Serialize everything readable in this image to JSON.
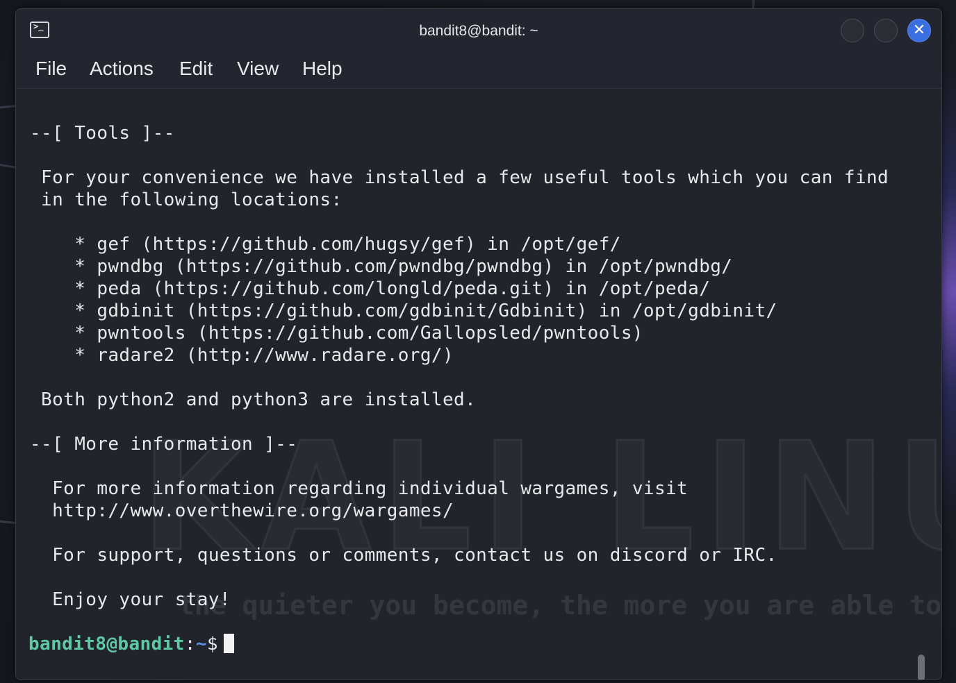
{
  "window": {
    "title": "bandit8@bandit: ~",
    "icon": "terminal-icon"
  },
  "menu": {
    "items": [
      "File",
      "Actions",
      "Edit",
      "View",
      "Help"
    ]
  },
  "background": {
    "watermark": "KALI LINUX",
    "tagline": "the quieter you become, the more you are able to"
  },
  "terminal": {
    "lines": [
      "--[ Tools ]--",
      " For your convenience we have installed a few useful tools which you can find",
      " in the following locations:",
      "    * gef (https://github.com/hugsy/gef) in /opt/gef/",
      "    * pwndbg (https://github.com/pwndbg/pwndbg) in /opt/pwndbg/",
      "    * peda (https://github.com/longld/peda.git) in /opt/peda/",
      "    * gdbinit (https://github.com/gdbinit/Gdbinit) in /opt/gdbinit/",
      "    * pwntools (https://github.com/Gallopsled/pwntools)",
      "    * radare2 (http://www.radare.org/)",
      " Both python2 and python3 are installed.",
      "--[ More information ]--",
      "  For more information regarding individual wargames, visit",
      "  http://www.overthewire.org/wargames/",
      "  For support, questions or comments, contact us on discord or IRC.",
      "  Enjoy your stay!"
    ],
    "prompt": {
      "user_host": "bandit8@bandit",
      "separator": ":",
      "path": "~",
      "symbol": "$"
    }
  },
  "colors": {
    "prompt_user": "#5fc9a5",
    "prompt_path": "#5a8fe8",
    "close_button": "#3b6fe0"
  }
}
